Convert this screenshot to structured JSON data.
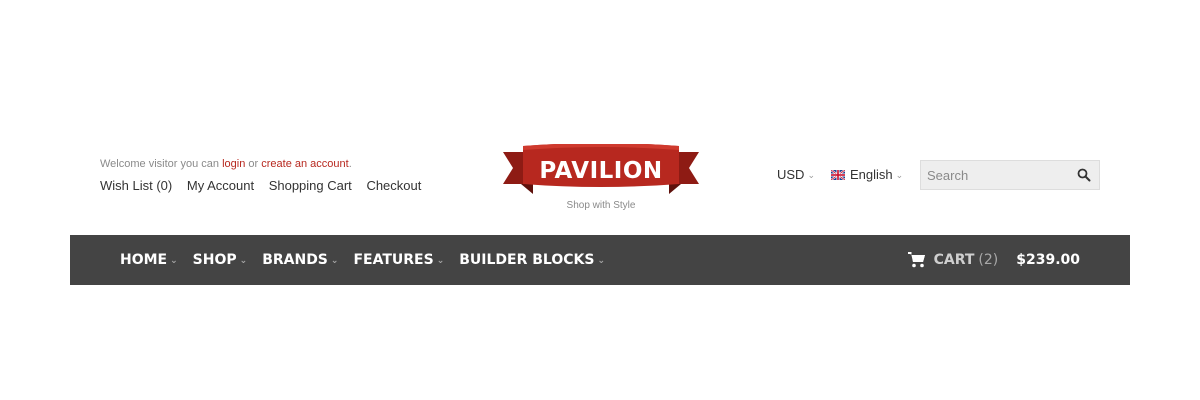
{
  "colors": {
    "accent_red": "#b7281f",
    "nav_background": "#444444",
    "nav_text": "#ffffff",
    "body_text": "#333333",
    "muted_text": "#8a8a8a"
  },
  "header": {
    "welcome": {
      "prefix": "Welcome visitor you can ",
      "login_link": "login",
      "middle": " or ",
      "create_account_link": "create an account",
      "suffix": "."
    },
    "account_links": [
      "Wish List (0)",
      "My Account",
      "Shopping Cart",
      "Checkout"
    ],
    "logo": {
      "text": "PAVILION",
      "tagline": "Shop with Style"
    },
    "currency": {
      "selected": "USD",
      "icon": "chevron-down-icon"
    },
    "language": {
      "selected": "English",
      "icon": "uk-flag-icon"
    },
    "search": {
      "placeholder": "Search",
      "value": "",
      "icon": "search-icon"
    }
  },
  "nav": {
    "items": [
      {
        "label": "HOME"
      },
      {
        "label": "SHOP"
      },
      {
        "label": "BRANDS"
      },
      {
        "label": "FEATURES"
      },
      {
        "label": "BUILDER BLOCKS"
      }
    ],
    "cart": {
      "icon": "cart-icon",
      "label": "CART",
      "count": "(2)",
      "total": "$239.00"
    }
  }
}
